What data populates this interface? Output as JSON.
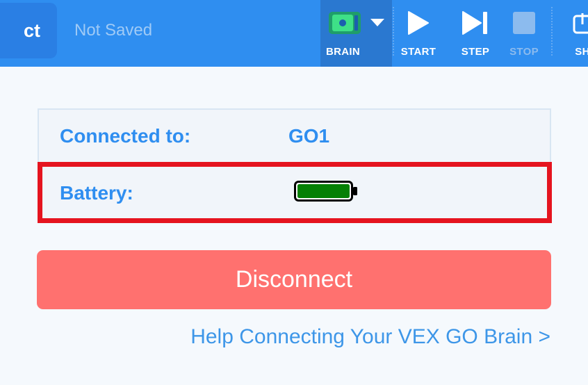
{
  "toolbar": {
    "project_label": "ct",
    "save_status": "Not Saved",
    "brain_label": "BRAIN",
    "start_label": "START",
    "step_label": "STEP",
    "stop_label": "STOP",
    "share_label": "SH"
  },
  "connection": {
    "connected_label": "Connected to:",
    "device_name": "GO1",
    "battery_label": "Battery:",
    "battery_level_percent": 100
  },
  "disconnect_label": "Disconnect",
  "help_link": "Help Connecting Your VEX GO Brain >",
  "colors": {
    "toolbar": "#2f8ef0",
    "accent_text": "#2f8ef0",
    "disconnect": "#ff716f",
    "highlight": "#e5141f",
    "battery_fill": "#058005"
  }
}
